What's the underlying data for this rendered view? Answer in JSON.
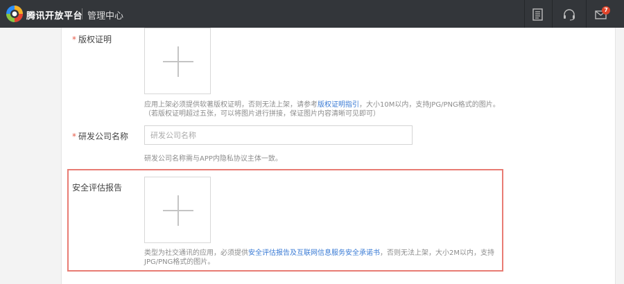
{
  "topbar": {
    "brand": "腾讯开放平台",
    "console": "管理中心",
    "icons": [
      "document-icon",
      "headset-icon",
      "mail-icon"
    ],
    "mail_badge": "7",
    "colors": {
      "background": "#33363a",
      "badge": "#e0452b"
    }
  },
  "form": {
    "copyright": {
      "required_mark": "*",
      "label": "版权证明",
      "hint_prefix": "应用上架必须提供软著版权证明，否则无法上架，请参考",
      "hint_link": "版权证明指引",
      "hint_suffix": "，大小10M以内，支持JPG/PNG格式的图片。",
      "hint_line2": "（若版权证明超过五张，可以将图片进行拼接，保证图片内容清晰可见即可）"
    },
    "company": {
      "required_mark": "*",
      "label": "研发公司名称",
      "placeholder": "研发公司名称",
      "value": "",
      "hint": "研发公司名称需与APP内隐私协议主体一致。"
    },
    "security": {
      "label": "安全评估报告",
      "hint_prefix": "类型为社交通讯的应用，必须提供",
      "hint_link": "安全评估报告及互联网信息服务安全承诺书",
      "hint_suffix": "，否则无法上架，大小2M以内，支持",
      "hint_line2": "JPG/PNG格式的图片。"
    }
  },
  "colors": {
    "required": "#e65b49",
    "link": "#3a7bd5",
    "highlight_border": "#e87b73"
  }
}
